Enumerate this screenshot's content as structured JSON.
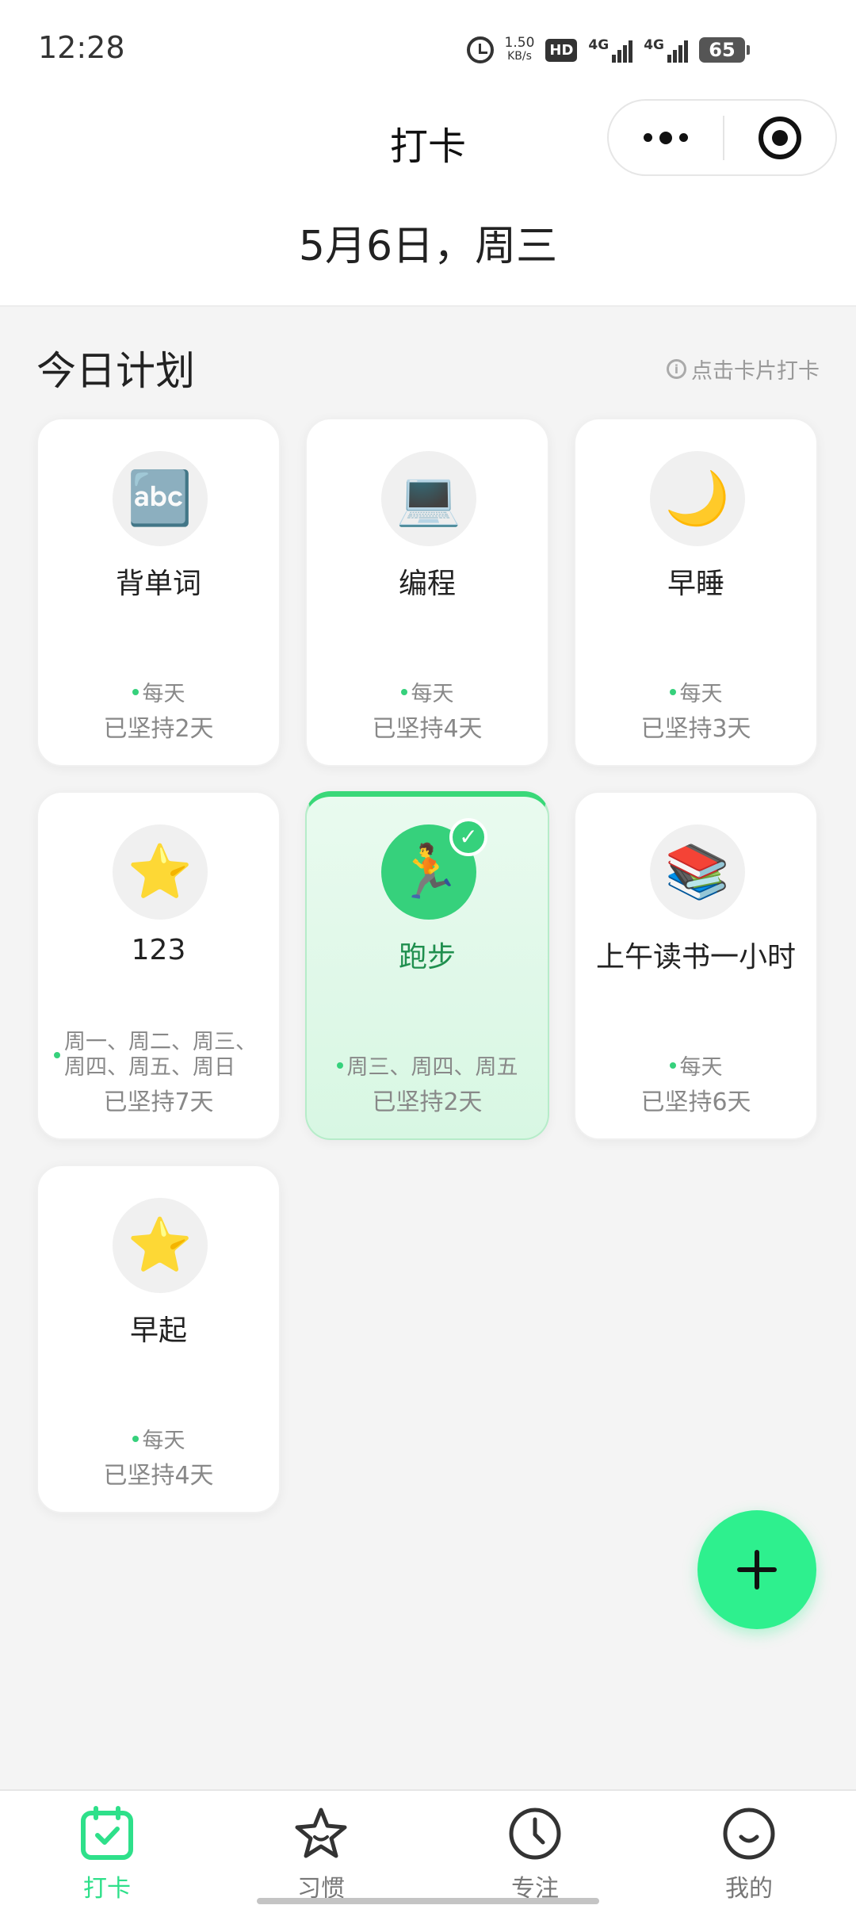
{
  "status_bar": {
    "time": "12:28",
    "net_speed_value": "1.50",
    "net_speed_unit": "KB/s",
    "hd_label": "HD",
    "sim1": "4G",
    "sim2": "4G",
    "battery": "65"
  },
  "header": {
    "title": "打卡",
    "date": "5月6日，周三"
  },
  "section": {
    "title": "今日计划",
    "hint": "点击卡片打卡",
    "hint_icon": "i"
  },
  "habits": [
    {
      "name": "背单词",
      "icon": "🔤",
      "frequency": "每天",
      "streak": "已坚持2天",
      "done": false
    },
    {
      "name": "编程",
      "icon": "💻",
      "frequency": "每天",
      "streak": "已坚持4天",
      "done": false
    },
    {
      "name": "早睡",
      "icon": "🌙",
      "frequency": "每天",
      "streak": "已坚持3天",
      "done": false
    },
    {
      "name": "123",
      "icon": "⭐",
      "frequency": "周一、周二、周三、周四、周五、周日",
      "streak": "已坚持7天",
      "done": false
    },
    {
      "name": "跑步",
      "icon": "🏃",
      "frequency": "周三、周四、周五",
      "streak": "已坚持2天",
      "done": true,
      "check": "✓"
    },
    {
      "name": "上午读书一小时",
      "icon": "📚",
      "frequency": "每天",
      "streak": "已坚持6天",
      "done": false
    },
    {
      "name": "早起",
      "icon": "⭐",
      "frequency": "每天",
      "streak": "已坚持4天",
      "done": false
    }
  ],
  "fab": {
    "icon": "plus-icon"
  },
  "tabs": [
    {
      "label": "打卡",
      "icon": "calendar-check-icon",
      "active": true
    },
    {
      "label": "习惯",
      "icon": "star-icon",
      "active": false
    },
    {
      "label": "专注",
      "icon": "clock-icon",
      "active": false
    },
    {
      "label": "我的",
      "icon": "smile-icon",
      "active": false
    }
  ],
  "colors": {
    "accent": "#2ee08a",
    "done_card_bg": "#e1f8e9",
    "fab": "#2ef08e",
    "page_bg": "#f4f4f4"
  }
}
